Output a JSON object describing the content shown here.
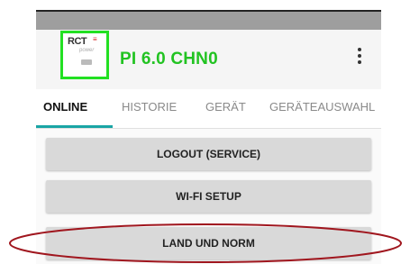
{
  "appbar": {
    "logo_text": "RCT",
    "logo_sub": "power",
    "device_name": "PI 6.0 CHN0"
  },
  "tabs": [
    {
      "label": "ONLINE",
      "active": true
    },
    {
      "label": "HISTORIE",
      "active": false
    },
    {
      "label": "GERÄT",
      "active": false
    },
    {
      "label": "GERÄTEAUSWAHL",
      "active": false
    }
  ],
  "buttons": {
    "logout": "LOGOUT (SERVICE)",
    "wifi": "WI-FI SETUP",
    "land": "LAND UND NORM"
  },
  "colors": {
    "device_name": "#22c322",
    "logo_border": "#22e022",
    "tab_indicator": "#1aa5a5",
    "highlight_ellipse": "#a0161e",
    "button_bg": "#d9d9d9"
  },
  "icons": {
    "menu": "more-vert-icon",
    "logo": "rct-power-logo"
  }
}
